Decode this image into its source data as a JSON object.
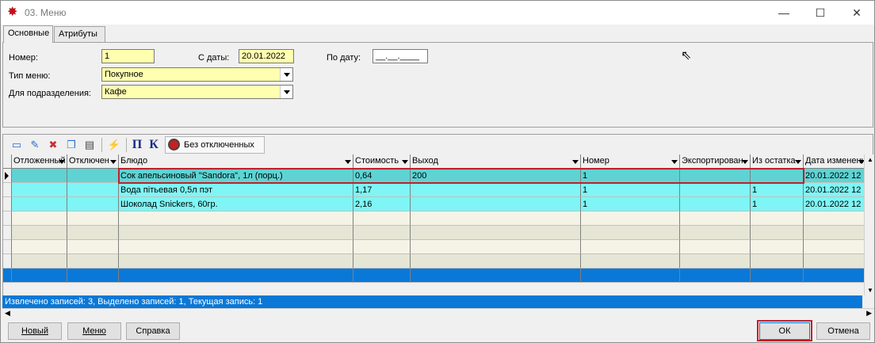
{
  "window": {
    "title": "03. Меню"
  },
  "tabs": [
    "Основные",
    "Атрибуты"
  ],
  "form": {
    "number_label": "Номер:",
    "number_value": "1",
    "from_label": "С даты:",
    "from_value": "20.01.2022",
    "to_label": "По дату:",
    "to_value": "__.__.____",
    "menu_type_label": "Тип меню:",
    "menu_type_value": "Покупное",
    "division_label": "Для подразделения:",
    "division_value": "Кафе"
  },
  "toolbar": {
    "filter_label": "Без отключенных",
    "pi_label": "П",
    "k_label": "К"
  },
  "grid": {
    "columns": [
      "Отложенный",
      "Отключен",
      "Блюдо",
      "Стоимость",
      "Выход",
      "Номер",
      "Экспортирован",
      "Из остатка",
      "Дата изменения"
    ],
    "rows": [
      [
        "",
        "",
        "Сок апельсиновый \"Sandora\", 1л (порц.)",
        "0,64",
        "200",
        "1",
        "",
        "",
        "20.01.2022 12"
      ],
      [
        "",
        "",
        "Вода пітьевая 0,5л пэт",
        "1,17",
        "",
        "1",
        "",
        "1",
        "20.01.2022 12"
      ],
      [
        "",
        "",
        "Шоколад Snickers, 60гр.",
        "2,16",
        "",
        "1",
        "",
        "1",
        "20.01.2022 12"
      ]
    ]
  },
  "status_text": "Извлечено записей: 3, Выделено записей: 1, Текущая запись: 1",
  "buttons": {
    "new": "Новый",
    "menu": "Меню",
    "help": "Справка",
    "ok": "ОК",
    "cancel": "Отмена"
  },
  "colors": {
    "row_selected": "#5fd3d3",
    "row_data": "#7ff5f5",
    "row_empty_odd": "#f5f3e6",
    "row_empty_even": "#e6e6d6",
    "status_bg": "#0a78d7",
    "highlight": "#c0202a"
  }
}
